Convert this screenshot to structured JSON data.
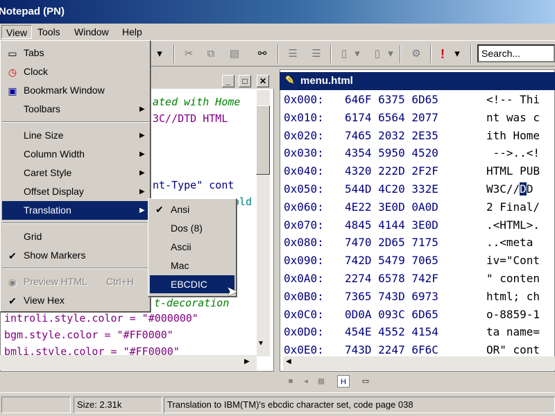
{
  "window": {
    "title": "Notepad (PN)"
  },
  "menubar": {
    "items": [
      "View",
      "Tools",
      "Window",
      "Help"
    ]
  },
  "toolbar": {
    "search_placeholder": "Search..."
  },
  "view_menu": {
    "items": [
      {
        "label": "Tabs",
        "icon": "tabs-icon",
        "glyph": "▭"
      },
      {
        "label": "Clock",
        "icon": "clock-icon",
        "glyph": "◷"
      },
      {
        "label": "Bookmark Window",
        "icon": "bookmark-window-icon",
        "glyph": "▣"
      },
      {
        "label": "Toolbars",
        "arrow": "▶"
      },
      {
        "label": "Line Size",
        "arrow": "▶"
      },
      {
        "label": "Column Width",
        "arrow": "▶"
      },
      {
        "label": "Caret Style",
        "arrow": "▶"
      },
      {
        "label": "Offset Display",
        "arrow": "▶"
      },
      {
        "label": "Translation",
        "arrow": "▶"
      },
      {
        "label": "Grid"
      },
      {
        "label": "Show Markers",
        "glyph": "✔"
      },
      {
        "label": "Preview HTML",
        "shortcut": "Ctrl+H",
        "glyph": "◉"
      },
      {
        "label": "View Hex",
        "glyph": "✔"
      }
    ]
  },
  "translation_menu": {
    "items": [
      {
        "label": "Ansi",
        "glyph": "✔"
      },
      {
        "label": "Dos (8)"
      },
      {
        "label": "Ascii"
      },
      {
        "label": "Mac"
      },
      {
        "label": "EBCDIC"
      }
    ]
  },
  "left_editor": {
    "lines": [
      "ated with Home",
      "3C//DTD HTML",
      "nt-Type\" cont",
      "old",
      "t-decoration",
      "introli.style.color = \"#000000\"",
      "bgm.style.color = \"#FF0000\"",
      "bmli.stvle.color = \"#FF0000\""
    ]
  },
  "hex_view": {
    "title": "menu.html",
    "rows": [
      {
        "addr": "0x000:",
        "bytes": "646F 6375 6D65",
        "text": "<!-- Thi"
      },
      {
        "addr": "0x010:",
        "bytes": "6174 6564 2077",
        "text": "nt was c"
      },
      {
        "addr": "0x020:",
        "bytes": "7465 2032 2E35",
        "text": "ith Home"
      },
      {
        "addr": "0x030:",
        "bytes": "4354 5950 4520",
        "text": " -->..<!"
      },
      {
        "addr": "0x040:",
        "bytes": "4320 222D 2F2F",
        "text": "HTML PUB"
      },
      {
        "addr": "0x050:",
        "bytes": "544D 4C20 332E",
        "text_pre": "W3C//",
        "text_hl": "D",
        "text_post": "D"
      },
      {
        "addr": "0x060:",
        "bytes": "4E22 3E0D 0A0D",
        "text": "2 Final/"
      },
      {
        "addr": "0x070:",
        "bytes": "4845 4144 3E0D",
        "text": ".<HTML>."
      },
      {
        "addr": "0x080:",
        "bytes": "7470 2D65 7175",
        "text": "..<meta "
      },
      {
        "addr": "0x090:",
        "bytes": "742D 5479 7065",
        "text": "iv=\"Cont"
      },
      {
        "addr": "0x0A0:",
        "bytes": "2274 6578 742F",
        "text": "\" conten"
      },
      {
        "addr": "0x0B0:",
        "bytes": "7365 743D 6973",
        "text": "html; ch"
      },
      {
        "addr": "0x0C0:",
        "bytes": "0D0A 093C 6D65",
        "text": "o-8859-1"
      },
      {
        "addr": "0x0D0:",
        "bytes": "454E 4552 4154",
        "text": "ta name="
      },
      {
        "addr": "0x0E0:",
        "bytes": "743D 2247 6F6C",
        "text": "OR\" cont"
      }
    ]
  },
  "statusbar": {
    "size": "Size: 2.31k",
    "message": "Translation to IBM(TM)'s ebcdic character set, code page 038"
  }
}
